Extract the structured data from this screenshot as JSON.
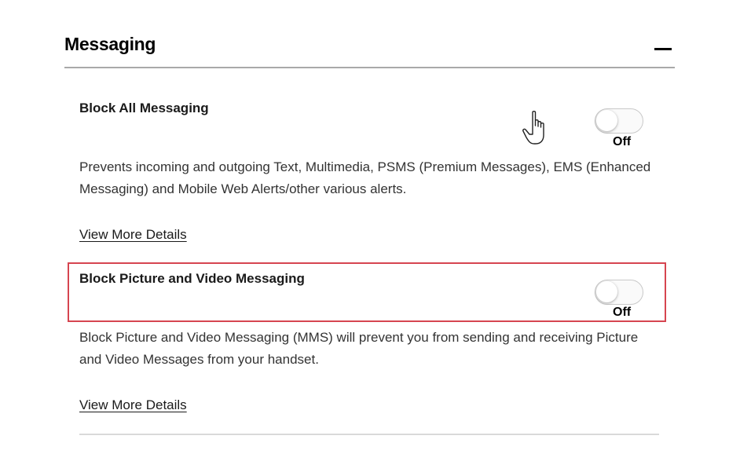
{
  "section": {
    "title": "Messaging",
    "collapse_icon": "minus-icon"
  },
  "items": [
    {
      "title": "Block All Messaging",
      "description": "Prevents incoming and outgoing Text, Multimedia, PSMS (Premium Messages), EMS (Enhanced Messaging) and Mobile Web Alerts/other various alerts.",
      "toggle_state": "Off",
      "link": "View More Details"
    },
    {
      "title": "Block Picture and Video Messaging",
      "description": "Block Picture and Video Messaging (MMS) will prevent you from sending and receiving Picture and Video Messages from your handset.",
      "toggle_state": "Off",
      "link": "View More Details"
    }
  ],
  "colors": {
    "highlight": "#d64550",
    "divider": "#a9a9a9"
  },
  "cursor": "hand-pointer-icon"
}
